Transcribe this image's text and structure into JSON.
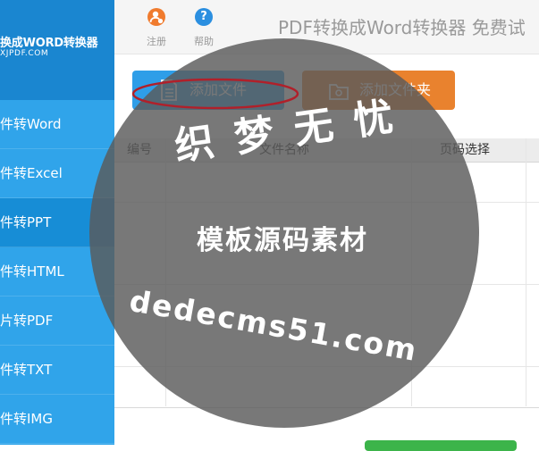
{
  "brand": {
    "name": "换成WORD转换器",
    "url": "XJPDF.COM"
  },
  "sidebar": {
    "items": [
      {
        "label": "件转Word"
      },
      {
        "label": "件转Excel"
      },
      {
        "label": "件转PPT"
      },
      {
        "label": "件转HTML"
      },
      {
        "label": "片转PDF"
      },
      {
        "label": "件转TXT"
      },
      {
        "label": "件转IMG"
      }
    ],
    "active_index": 2
  },
  "toolbar": {
    "register": {
      "label": "注册",
      "icon": "register-user-icon",
      "color": "#f07b2e"
    },
    "help": {
      "label": "帮助",
      "icon": "help-icon",
      "color": "#2b8fe0"
    },
    "title": "PDF转换成Word转换器 免费试"
  },
  "actions": {
    "add_file": {
      "label": "添加文件",
      "icon": "file-icon",
      "color": "#2e9ee8"
    },
    "add_folder": {
      "label": "添加文件夹",
      "icon": "folder-icon",
      "color": "#e9822e"
    }
  },
  "table": {
    "columns": [
      "编号",
      "文件名称",
      "页码选择"
    ]
  },
  "watermark": {
    "line1": "织 梦 无 忧",
    "line2": "模板源码素材",
    "line3": "dedecms51.com"
  }
}
